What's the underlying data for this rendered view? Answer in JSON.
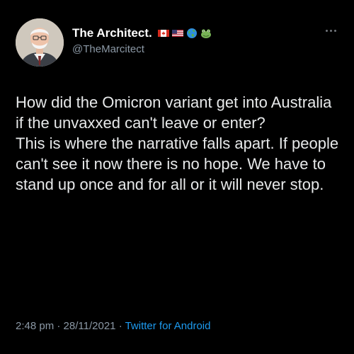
{
  "author": {
    "display_name": "The Architect.",
    "handle": "@TheMarcitect",
    "emoji_badges": [
      "canada-flag",
      "usa-flag",
      "globe-americas",
      "frog-face"
    ]
  },
  "tweet": {
    "paragraphs": [
      "How did the Omicron variant get into Australia if the unvaxxed can't leave or enter?",
      "This is where the narrative falls apart. If people can't see it now there is no hope. We have to stand up once and for all or it will never stop."
    ],
    "time": "2:48 pm",
    "date": "28/11/2021",
    "separator": "·",
    "source": "Twitter for Android"
  },
  "colors": {
    "background": "#000000",
    "text": "#e7e9ea",
    "muted": "#8b98a5",
    "link": "#1d9bf0"
  },
  "icons": {
    "more": "more-horizontal-icon"
  }
}
